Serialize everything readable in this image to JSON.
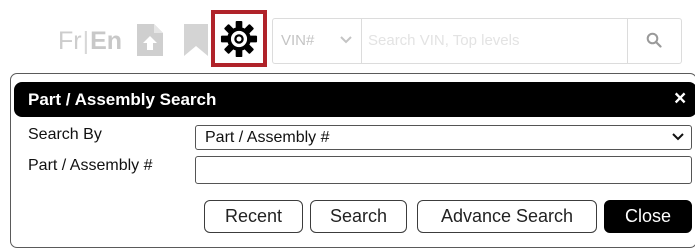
{
  "toolbar": {
    "lang_fr": "Fr",
    "lang_sep": "|",
    "lang_en": "En",
    "vin_select_value": "VIN#",
    "search_placeholder": "Search VIN, Top levels",
    "icons": [
      "file-upload-icon",
      "bookmark-icon",
      "gear-icon",
      "chevron-down-icon",
      "search-icon"
    ],
    "highlight_color": "#b0232a"
  },
  "dialog": {
    "title": "Part / Assembly Search",
    "close_glyph": "×",
    "search_by_label": "Search By",
    "search_by_value": "Part / Assembly #",
    "part_label": "Part / Assembly #",
    "part_value": "",
    "buttons": {
      "recent": "Recent",
      "search": "Search",
      "advance_search": "Advance Search",
      "close": "Close"
    }
  }
}
